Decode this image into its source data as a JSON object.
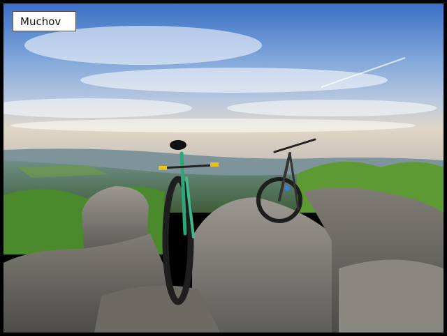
{
  "caption": {
    "text": "Muchov"
  },
  "colors": {
    "frame": "#000000",
    "sky_top": "#3f73c8",
    "sky_mid": "#8fb0de",
    "horizon": "#d9d2c4",
    "rock": "#7f7d78",
    "foliage": "#4f8a2a"
  },
  "scene": {
    "description_icon": "mountain-bike-photo"
  }
}
